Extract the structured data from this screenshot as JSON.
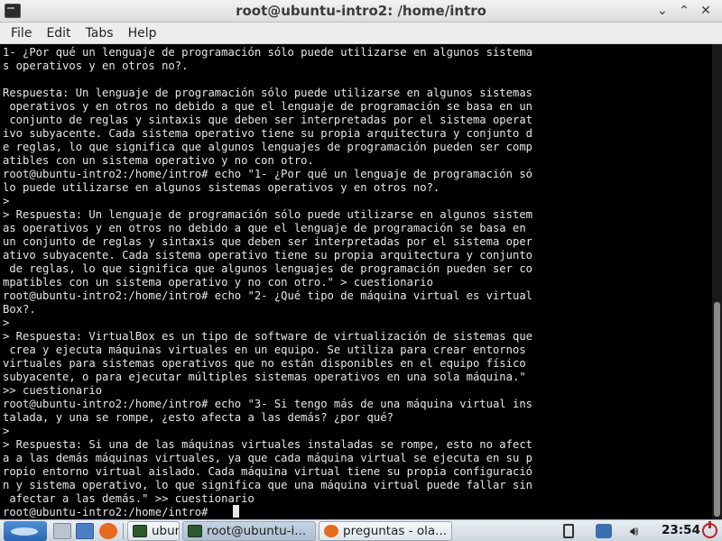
{
  "window": {
    "title": "root@ubuntu-intro2: /home/intro",
    "minimize_glyph": "⌄",
    "maximize_glyph": "⌃",
    "close_glyph": "✕"
  },
  "menu": {
    "items": [
      "File",
      "Edit",
      "Tabs",
      "Help"
    ]
  },
  "terminal": {
    "lines": [
      "1- ¿Por qué un lenguaje de programación sólo puede utilizarse en algunos sistema",
      "s operativos y en otros no?.",
      "",
      "Respuesta: Un lenguaje de programación sólo puede utilizarse en algunos sistemas",
      " operativos y en otros no debido a que el lenguaje de programación se basa en un",
      " conjunto de reglas y sintaxis que deben ser interpretadas por el sistema operat",
      "ivo subyacente. Cada sistema operativo tiene su propia arquitectura y conjunto d",
      "e reglas, lo que significa que algunos lenguajes de programación pueden ser comp",
      "atibles con un sistema operativo y no con otro.",
      "root@ubuntu-intro2:/home/intro# echo \"1- ¿Por qué un lenguaje de programación só",
      "lo puede utilizarse en algunos sistemas operativos y en otros no?.",
      ">",
      "> Respuesta: Un lenguaje de programación sólo puede utilizarse en algunos sistem",
      "as operativos y en otros no debido a que el lenguaje de programación se basa en",
      "un conjunto de reglas y sintaxis que deben ser interpretadas por el sistema oper",
      "ativo subyacente. Cada sistema operativo tiene su propia arquitectura y conjunto",
      " de reglas, lo que significa que algunos lenguajes de programación pueden ser co",
      "mpatibles con un sistema operativo y no con otro.\" > cuestionario",
      "root@ubuntu-intro2:/home/intro# echo \"2- ¿Qué tipo de máquina virtual es virtual",
      "Box?.",
      ">",
      "> Respuesta: VirtualBox es un tipo de software de virtualización de sistemas que",
      " crea y ejecuta máquinas virtuales en un equipo. Se utiliza para crear entornos",
      "virtuales para sistemas operativos que no están disponibles en el equipo físico",
      "subyacente, o para ejecutar múltiples sistemas operativos en una sola máquina.\"",
      ">> cuestionario",
      "root@ubuntu-intro2:/home/intro# echo \"3- Si tengo más de una máquina virtual ins",
      "talada, y una se rompe, ¿esto afecta a las demás? ¿por qué?",
      ">",
      "> Respuesta: Si una de las máquinas virtuales instaladas se rompe, esto no afect",
      "a a las demás máquinas virtuales, ya que cada máquina virtual se ejecuta en su p",
      "ropio entorno virtual aislado. Cada máquina virtual tiene su propia configuració",
      "n y sistema operativo, lo que significa que una máquina virtual puede fallar sin",
      " afectar a las demás.\" >> cuestionario",
      "root@ubuntu-intro2:/home/intro# "
    ]
  },
  "taskbar": {
    "tasks": [
      {
        "label": "ubuntu-i...",
        "icon": "terminal-icon",
        "active": false
      },
      {
        "label": "root@ubuntu-i...",
        "icon": "terminal-icon",
        "active": true
      },
      {
        "label": "preguntas - ola...",
        "icon": "firefox-icon",
        "active": false
      }
    ],
    "clock": "23:54",
    "colors": {
      "start_button": "#2a66b0",
      "folder_icon": "#4a7fc4",
      "firefox_icon": "#e66a1f",
      "terminal_icon": "#2d5a2d"
    }
  }
}
